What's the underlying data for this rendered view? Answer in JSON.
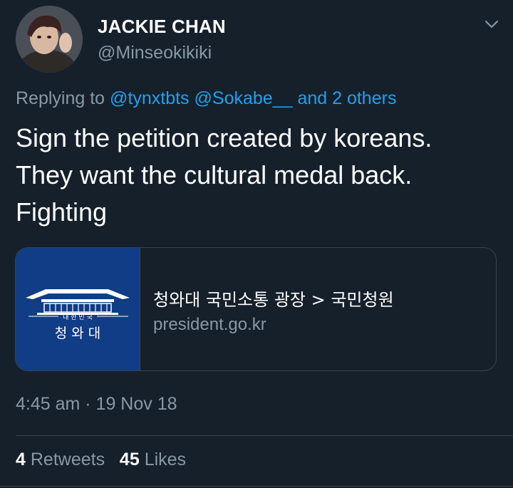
{
  "tweet": {
    "display_name": "JACKIE CHAN",
    "handle": "@Minseokikiki",
    "replying_prefix": "Replying to",
    "reply_mentions": [
      "@tynxtbts",
      "@Sokabe__"
    ],
    "reply_others": "and 2 others",
    "text_lines": [
      "Sign the petition created by koreans.",
      "They want the cultural medal back.",
      "Fighting"
    ],
    "timestamp": "4:45 am · 19 Nov 18"
  },
  "card": {
    "title": "청와대 국민소통 광장 > 국민청원",
    "domain": "president.go.kr",
    "thumb_label_small": "대 한 민 국",
    "thumb_label_large": "청 와 대"
  },
  "stats": {
    "retweets_count": "4",
    "retweets_label": "Retweets",
    "likes_count": "45",
    "likes_label": "Likes"
  },
  "colors": {
    "background": "#15202b",
    "link": "#1da1f2",
    "secondary_text": "#8899a6",
    "card_thumb": "#113c86"
  }
}
